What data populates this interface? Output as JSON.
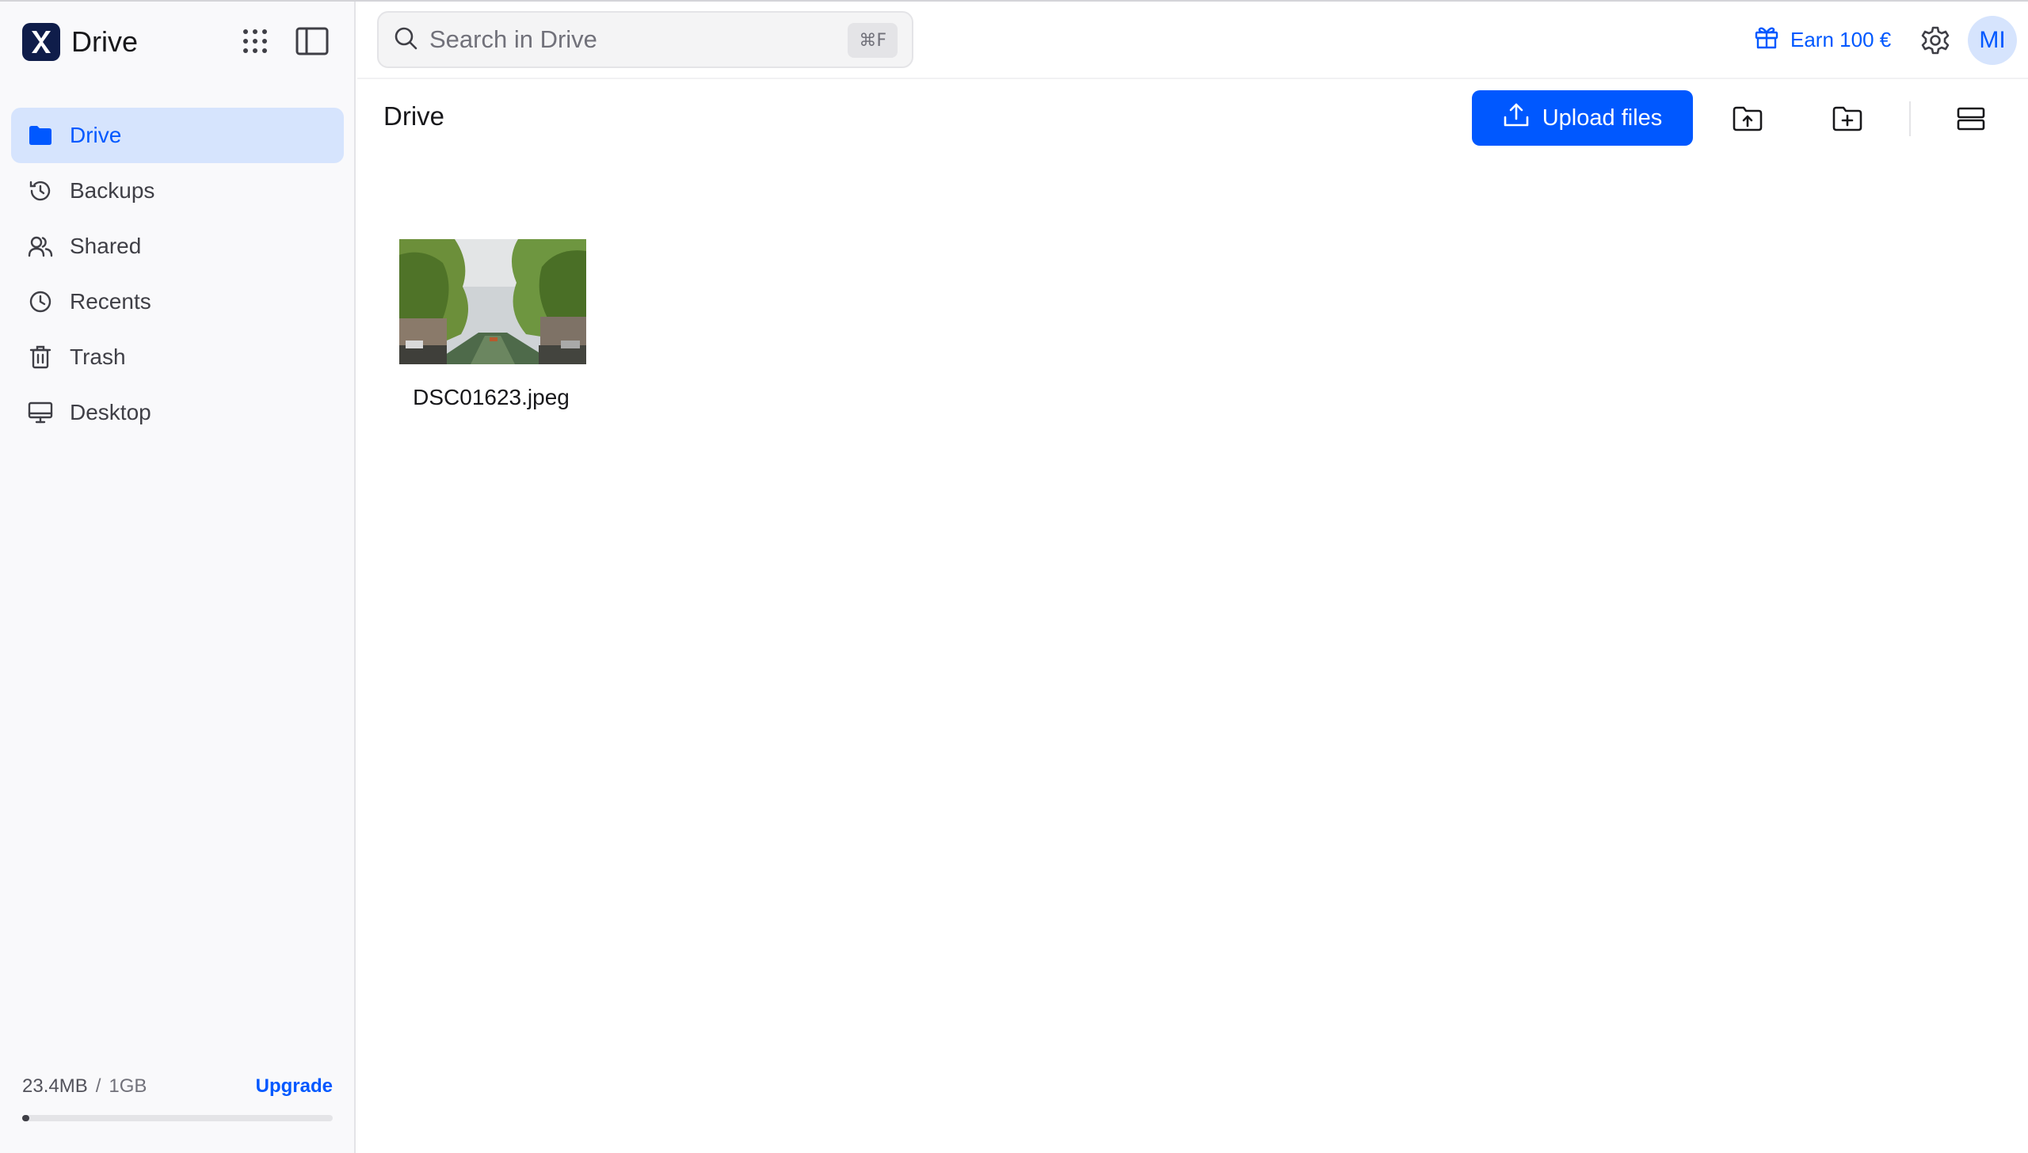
{
  "app": {
    "name": "Drive"
  },
  "search": {
    "placeholder": "Search in Drive",
    "shortcut": "⌘F"
  },
  "topbar": {
    "earn_label": "Earn 100 €",
    "avatar_initials": "MI"
  },
  "sidebar": {
    "items": [
      {
        "label": "Drive",
        "icon": "folder-icon",
        "active": true
      },
      {
        "label": "Backups",
        "icon": "history-icon",
        "active": false
      },
      {
        "label": "Shared",
        "icon": "users-icon",
        "active": false
      },
      {
        "label": "Recents",
        "icon": "clock-icon",
        "active": false
      },
      {
        "label": "Trash",
        "icon": "trash-icon",
        "active": false
      },
      {
        "label": "Desktop",
        "icon": "desktop-icon",
        "active": false
      }
    ],
    "storage": {
      "used": "23.4MB",
      "separator": "/",
      "total": "1GB",
      "upgrade_label": "Upgrade",
      "used_fraction": 0.023
    }
  },
  "main": {
    "title": "Drive",
    "upload_label": "Upload files",
    "files": [
      {
        "name": "DSC01623.jpeg",
        "type": "image"
      }
    ]
  },
  "colors": {
    "accent": "#0058ff",
    "active_bg": "#d6e4fd",
    "logo_bg": "#0f1d4a"
  }
}
